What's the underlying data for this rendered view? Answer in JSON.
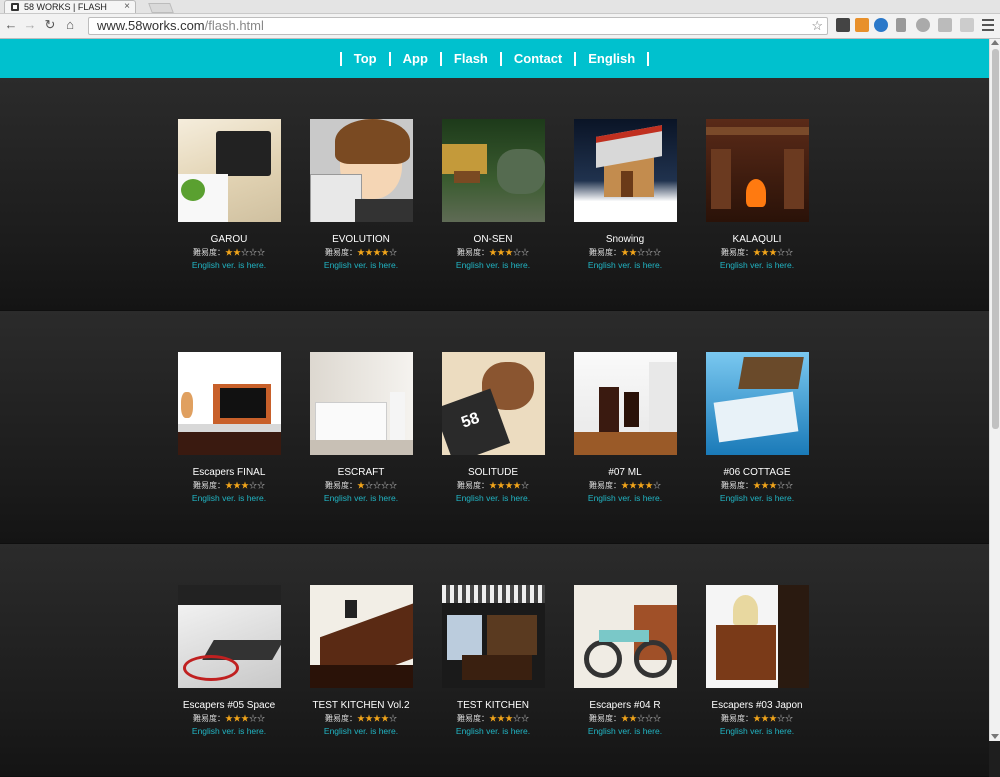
{
  "browser": {
    "tab_title": "58 WORKS | FLASH",
    "tab_close": "×",
    "url_host": "www.58works.com",
    "url_path": "/flash.html",
    "back": "←",
    "forward": "→",
    "reload": "↻",
    "home": "⌂",
    "star": "☆"
  },
  "nav": {
    "items": [
      "Top",
      "App",
      "Flash",
      "Contact",
      "English"
    ]
  },
  "difficulty_label": "難易度：",
  "star_on": "★",
  "star_off": "☆",
  "english_link": "English ver. is here.",
  "colors": {
    "header": "#00c1ce",
    "link": "#21b5c4",
    "star": "#f2a51a"
  },
  "rows": [
    {
      "games": [
        {
          "title": "GAROU",
          "stars": 2
        },
        {
          "title": "EVOLUTION",
          "stars": 4
        },
        {
          "title": "ON-SEN",
          "stars": 3
        },
        {
          "title": "Snowing",
          "stars": 2
        },
        {
          "title": "KALAQULI",
          "stars": 3
        }
      ]
    },
    {
      "games": [
        {
          "title": "Escapers FINAL",
          "stars": 3
        },
        {
          "title": "ESCRAFT",
          "stars": 1
        },
        {
          "title": "SOLITUDE",
          "stars": 4
        },
        {
          "title": "#07 ML",
          "stars": 4
        },
        {
          "title": "#06 COTTAGE",
          "stars": 3
        }
      ]
    },
    {
      "games": [
        {
          "title": "Escapers #05 Space",
          "stars": 3
        },
        {
          "title": "TEST KITCHEN Vol.2",
          "stars": 4
        },
        {
          "title": "TEST KITCHEN",
          "stars": 3
        },
        {
          "title": "Escapers #04 R",
          "stars": 2
        },
        {
          "title": "Escapers #03 Japon",
          "stars": 3
        }
      ]
    }
  ]
}
